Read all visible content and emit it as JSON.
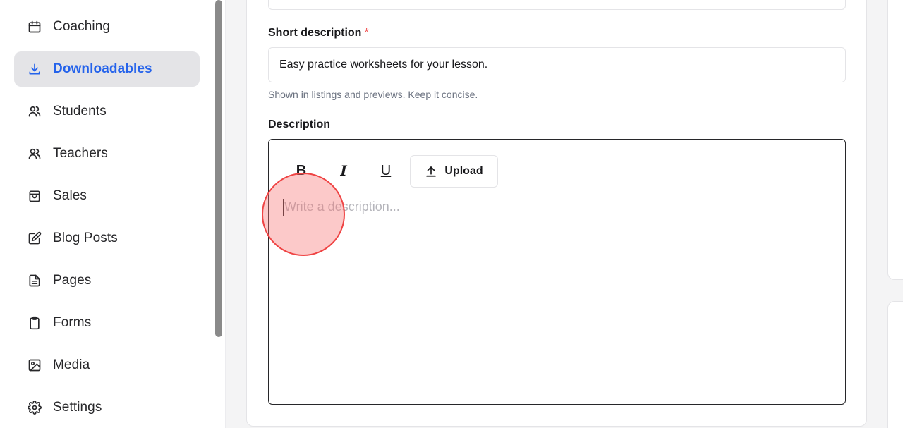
{
  "sidebar": {
    "items": [
      {
        "label": "Coaching",
        "icon": "calendar-icon",
        "active": false
      },
      {
        "label": "Downloadables",
        "icon": "download-icon",
        "active": true
      },
      {
        "label": "Students",
        "icon": "users-icon",
        "active": false
      },
      {
        "label": "Teachers",
        "icon": "users-icon",
        "active": false
      },
      {
        "label": "Sales",
        "icon": "shopping-bag-icon",
        "active": false
      },
      {
        "label": "Blog Posts",
        "icon": "edit-icon",
        "active": false
      },
      {
        "label": "Pages",
        "icon": "document-icon",
        "active": false
      },
      {
        "label": "Forms",
        "icon": "clipboard-icon",
        "active": false
      },
      {
        "label": "Media",
        "icon": "image-icon",
        "active": false
      },
      {
        "label": "Settings",
        "icon": "gear-icon",
        "active": false
      }
    ]
  },
  "form": {
    "short_description": {
      "label": "Short description",
      "required_marker": "*",
      "value": "Easy practice worksheets for your lesson.",
      "hint": "Shown in listings and previews. Keep it concise."
    },
    "description": {
      "label": "Description",
      "toolbar": {
        "bold": "B",
        "italic": "I",
        "underline": "U",
        "upload": "Upload"
      },
      "placeholder": "Write a description..."
    }
  },
  "colors": {
    "accent": "#2563eb",
    "active_bg": "#e4e4e7",
    "required": "#ef4444",
    "click_marker": "#ef4444"
  }
}
